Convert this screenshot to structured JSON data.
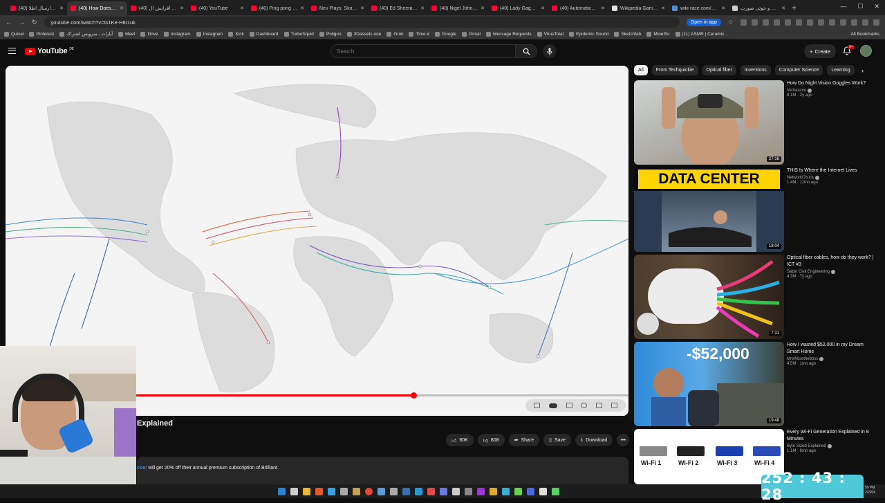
{
  "browser": {
    "tabs": [
      {
        "title": "نحوه ارسال اطلا (40)",
        "color": "#ff0033",
        "active": false
      },
      {
        "title": "(40) How Does LIGH",
        "color": "#ff0033",
        "active": true
      },
      {
        "title": "ساخت افزایش ال (40)",
        "color": "#ff0033",
        "active": false
      },
      {
        "title": "(40) YouTube",
        "color": "#ff0033",
        "active": false
      },
      {
        "title": "(40) Ping pong vs T",
        "color": "#ff0033",
        "active": false
      },
      {
        "title": "Nev Plays: Skrillex",
        "color": "#ff0033",
        "active": false
      },
      {
        "title": "(40) Ed Sheeran - Sl",
        "color": "#ff0033",
        "active": false
      },
      {
        "title": "(40) Nigel John Stan",
        "color": "#ff0033",
        "active": false
      },
      {
        "title": "(40) Lady Gaga - Ab",
        "color": "#ff0033",
        "active": false
      },
      {
        "title": "(40) Automatica: Ro",
        "color": "#ff0033",
        "active": false
      },
      {
        "title": "Wikipedia Game to",
        "color": "#e0e0e0",
        "active": false
      },
      {
        "title": "wiki-race.com/gam",
        "color": "#4a90d9",
        "active": false
      },
      {
        "title": "ابتدایات و جوئی صورت",
        "color": "#cccccc",
        "active": false
      }
    ],
    "url": "youtube.com/watch?v=G1Ke-H8I1uk",
    "open_in_app": "Open in app",
    "bookmarks": [
      "Quixel",
      "Pinterest",
      "آپارات - سرویس اشتراک",
      "Meet",
      "Drive",
      "Instagram",
      "Instagram",
      "Kick",
      "Dashboard",
      "TurboSquid",
      "Poligon",
      "3Dassets.one",
      "Grok",
      "Time.ir",
      "Google",
      "Gmail",
      "Message Requests",
      "VirusTotal",
      "Epidemic Sound",
      "Sketchfab",
      "MinePic",
      "(11) ASMR | Ceramic..."
    ],
    "all_bookmarks": "All Bookmarks"
  },
  "header": {
    "logo_text": "YouTube",
    "region": "DE",
    "search_placeholder": "Search",
    "create_label": "Create",
    "notification_count": "9+"
  },
  "player": {
    "progress_fraction": 0.655
  },
  "video": {
    "title_visible": "Explained",
    "likes": "60K",
    "dislikes": "808",
    "share_label": "Share",
    "save_label": "Save",
    "download_label": "Download",
    "description_link": "ckie/",
    "description_text": " will get 20% off their annual premium subscription of Brilliant."
  },
  "sidebar": {
    "chips": [
      "All",
      "From Techquickie",
      "Optical fiber",
      "Inventions",
      "Computer Science",
      "Learning"
    ],
    "recommendations": [
      {
        "title": "How Do Night Vision Goggles Work?",
        "channel": "Veritasium",
        "meta": "8.1M · 2y ago",
        "duration": "27:16"
      },
      {
        "title": "THIS Is Where the Internet Lives",
        "channel": "NetworkChuck",
        "meta": "1.4M · 11mo ago",
        "duration": "18:04",
        "thumb_text": "DATA CENTER"
      },
      {
        "title": "Optical fiber cables, how do they work? | ICT #3",
        "channel": "Sabin Civil Engineering",
        "meta": "4.3M · 7y ago",
        "duration": "7:31"
      },
      {
        "title": "How I wasted $52,000 in my Dream Smart Home",
        "channel": "Mrwhosetheboss",
        "meta": "4.5M · 1mo ago",
        "duration": "19:48",
        "thumb_text": "-$52,000"
      },
      {
        "title": "Every Wi-Fi Generation Explained in 8 Minutes",
        "channel": "Byte Sized Explained",
        "meta": "1.1M · 8mo ago",
        "duration": "",
        "wifi_labels": [
          "Wi-Fi 1",
          "Wi-Fi 2",
          "Wi-Fi 3",
          "Wi-Fi 4"
        ]
      }
    ]
  },
  "overlay": {
    "timer": "252 : 43 : 28"
  },
  "tray": {
    "time": "59 PM",
    "date": "2/2026"
  },
  "colors": {
    "accent": "#ff0000",
    "timer_bg": "#4fc8d8"
  }
}
